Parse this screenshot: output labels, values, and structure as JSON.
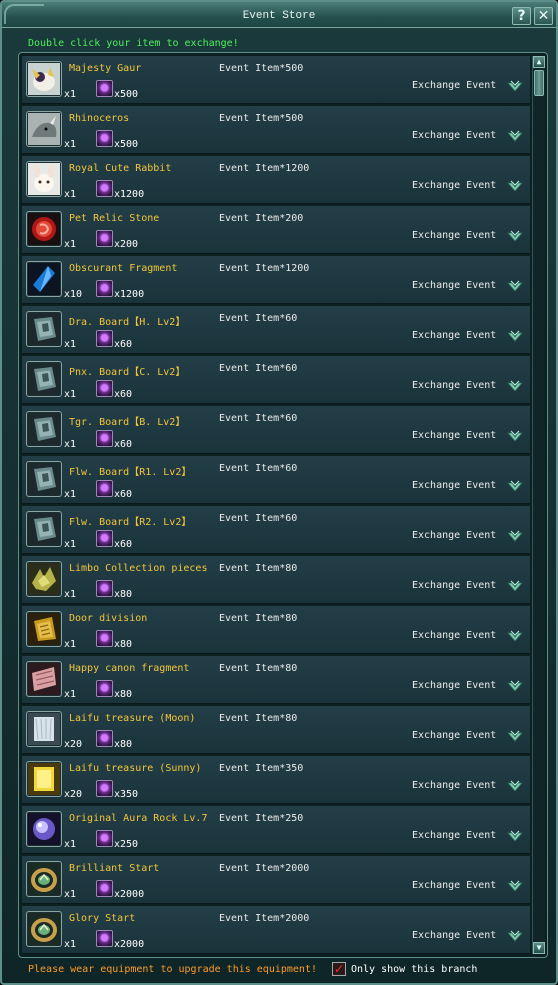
{
  "window": {
    "title": "Event Store",
    "help_label": "?",
    "close_label": "✕"
  },
  "instruction": "Double click your item to exchange!",
  "items": [
    {
      "name": "Majesty Gaur",
      "qty": "x1",
      "cost_amount": "x500",
      "cost_label": "Event Item*500",
      "exchange_label": "Exchange Event",
      "icon": "majesty-gaur-icon"
    },
    {
      "name": "Rhinoceros",
      "qty": "x1",
      "cost_amount": "x500",
      "cost_label": "Event Item*500",
      "exchange_label": "Exchange Event",
      "icon": "rhinoceros-icon"
    },
    {
      "name": "Royal Cute Rabbit",
      "qty": "x1",
      "cost_amount": "x1200",
      "cost_label": "Event Item*1200",
      "exchange_label": "Exchange Event",
      "icon": "rabbit-icon"
    },
    {
      "name": "Pet Relic Stone",
      "qty": "x1",
      "cost_amount": "x200",
      "cost_label": "Event Item*200",
      "exchange_label": "Exchange Event",
      "icon": "relic-stone-icon"
    },
    {
      "name": "Obscurant Fragment",
      "qty": "x10",
      "cost_amount": "x1200",
      "cost_label": "Event Item*1200",
      "exchange_label": "Exchange Event",
      "icon": "crystal-fragment-icon"
    },
    {
      "name": "Dra. Board【H. Lv2】",
      "qty": "x1",
      "cost_amount": "x60",
      "cost_label": "Event Item*60",
      "exchange_label": "Exchange Event",
      "icon": "board-book-icon"
    },
    {
      "name": "Pnx. Board【C. Lv2】",
      "qty": "x1",
      "cost_amount": "x60",
      "cost_label": "Event Item*60",
      "exchange_label": "Exchange Event",
      "icon": "board-book-icon"
    },
    {
      "name": "Tgr. Board【B. Lv2】",
      "qty": "x1",
      "cost_amount": "x60",
      "cost_label": "Event Item*60",
      "exchange_label": "Exchange Event",
      "icon": "board-book-icon"
    },
    {
      "name": "Flw. Board【R1. Lv2】",
      "qty": "x1",
      "cost_amount": "x60",
      "cost_label": "Event Item*60",
      "exchange_label": "Exchange Event",
      "icon": "board-book-icon"
    },
    {
      "name": "Flw. Board【R2. Lv2】",
      "qty": "x1",
      "cost_amount": "x60",
      "cost_label": "Event Item*60",
      "exchange_label": "Exchange Event",
      "icon": "board-book-icon"
    },
    {
      "name": "Limbo Collection pieces",
      "qty": "x1",
      "cost_amount": "x80",
      "cost_label": "Event Item*80",
      "exchange_label": "Exchange Event",
      "icon": "collection-pieces-icon"
    },
    {
      "name": "Door division",
      "qty": "x1",
      "cost_amount": "x80",
      "cost_label": "Event Item*80",
      "exchange_label": "Exchange Event",
      "icon": "door-division-icon"
    },
    {
      "name": "Happy canon fragment",
      "qty": "x1",
      "cost_amount": "x80",
      "cost_label": "Event Item*80",
      "exchange_label": "Exchange Event",
      "icon": "canon-fragment-icon"
    },
    {
      "name": "Laifu treasure (Moon)",
      "qty": "x20",
      "cost_amount": "x80",
      "cost_label": "Event Item*80",
      "exchange_label": "Exchange Event",
      "icon": "moon-treasure-icon"
    },
    {
      "name": "Laifu treasure (Sunny)",
      "qty": "x20",
      "cost_amount": "x350",
      "cost_label": "Event Item*350",
      "exchange_label": "Exchange Event",
      "icon": "sunny-treasure-icon"
    },
    {
      "name": "Original Aura Rock Lv.7",
      "qty": "x1",
      "cost_amount": "x250",
      "cost_label": "Event Item*250",
      "exchange_label": "Exchange Event",
      "icon": "aura-rock-icon"
    },
    {
      "name": "Brilliant Start",
      "qty": "x1",
      "cost_amount": "x2000",
      "cost_label": "Event Item*2000",
      "exchange_label": "Exchange Event",
      "icon": "ring-icon"
    },
    {
      "name": "Glory Start",
      "qty": "x1",
      "cost_amount": "x2000",
      "cost_label": "Event Item*2000",
      "exchange_label": "Exchange Event",
      "icon": "ring-icon"
    }
  ],
  "footer": {
    "note": "Please wear equipment to upgrade this equipment!",
    "checkbox_checked": true,
    "checkbox_mark": "✓",
    "checkbox_label": "Only show this branch"
  },
  "colors": {
    "item_name": "#f3c63a",
    "instruction": "#4cf05a",
    "footer_note": "#ff9a2a"
  }
}
